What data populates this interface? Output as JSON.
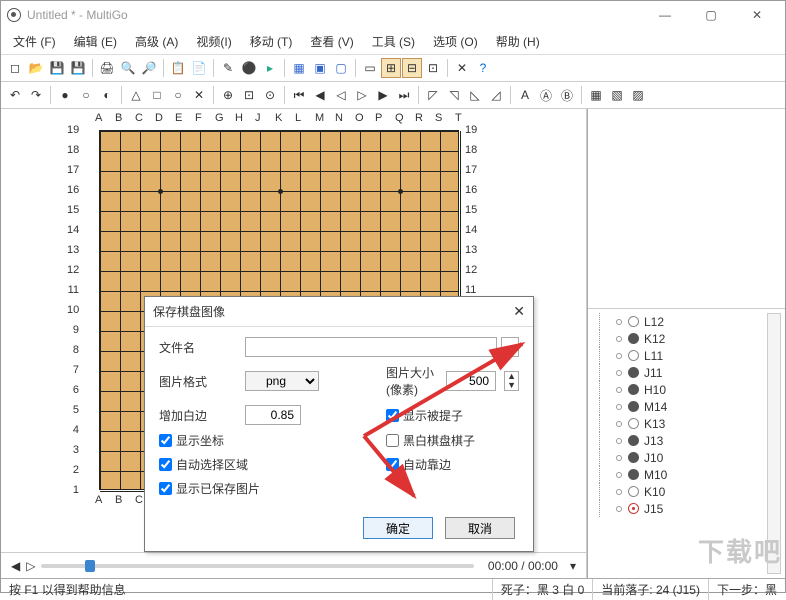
{
  "window": {
    "title": "Untitled  * - MultiGo"
  },
  "menu": [
    "文件 (F)",
    "编辑 (E)",
    "高级 (A)",
    "视频(I)",
    "移动 (T)",
    "查看 (V)",
    "工具 (S)",
    "选项 (O)",
    "帮助 (H)"
  ],
  "board": {
    "cols": [
      "A",
      "B",
      "C",
      "D",
      "E",
      "F",
      "G",
      "H",
      "J",
      "K",
      "L",
      "M",
      "N",
      "O",
      "P",
      "Q",
      "R",
      "S",
      "T"
    ],
    "rows": [
      "19",
      "18",
      "17",
      "16",
      "15",
      "14",
      "13",
      "12",
      "11",
      "10",
      "9",
      "8",
      "7",
      "6",
      "5",
      "4",
      "3",
      "2",
      "1"
    ]
  },
  "dialog": {
    "title": "保存棋盘图像",
    "labels": {
      "filename": "文件名",
      "format": "图片格式",
      "size": "图片大小 (像素)",
      "margin": "增加白边"
    },
    "values": {
      "filename": "",
      "format": "png",
      "size": "500",
      "margin": "0.85"
    },
    "checks": {
      "show_coords": "显示坐标",
      "auto_select": "自动选择区域",
      "show_saved": "显示已保存图片",
      "show_captured": "显示被提子",
      "bw_stones": "黑白棋盘棋子",
      "auto_edge": "自动靠边"
    },
    "buttons": {
      "ok": "确定",
      "cancel": "取消",
      "browse": "..."
    }
  },
  "moves": [
    {
      "color": "w",
      "label": "L12"
    },
    {
      "color": "b",
      "label": "K12"
    },
    {
      "color": "w",
      "label": "L11"
    },
    {
      "color": "b",
      "label": "J11"
    },
    {
      "color": "b",
      "label": "H10"
    },
    {
      "color": "b",
      "label": "M14"
    },
    {
      "color": "w",
      "label": "K13"
    },
    {
      "color": "b",
      "label": "J13"
    },
    {
      "color": "b",
      "label": "J10"
    },
    {
      "color": "b",
      "label": "M10"
    },
    {
      "color": "w",
      "label": "K10"
    },
    {
      "color": "r",
      "label": "J15"
    }
  ],
  "nav": {
    "time": "00:00 / 00:00"
  },
  "status": {
    "help": "按 F1 以得到帮助信息",
    "dead": "死子：黑 3 白 0",
    "current": "当前落子: 24 (J15)",
    "next": "下一步：黑"
  },
  "watermark": "下载吧"
}
